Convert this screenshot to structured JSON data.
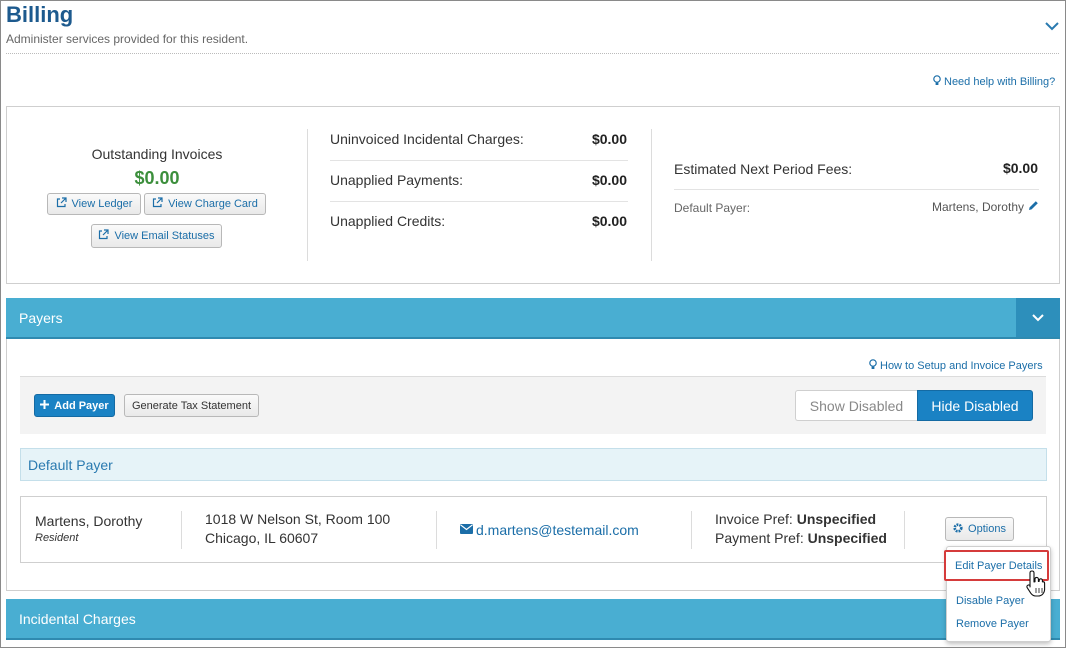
{
  "header": {
    "title": "Billing",
    "subtitle": "Administer services provided for this resident.",
    "help_link": "Need help with Billing?"
  },
  "summary": {
    "outstanding_label": "Outstanding Invoices",
    "outstanding_value": "$0.00",
    "view_ledger": "View Ledger",
    "view_charge_card": "View Charge Card",
    "view_email_statuses": "View Email Statuses",
    "rows": [
      {
        "label": "Uninvoiced Incidental Charges:",
        "value": "$0.00"
      },
      {
        "label": "Unapplied Payments:",
        "value": "$0.00"
      },
      {
        "label": "Unapplied Credits:",
        "value": "$0.00"
      }
    ],
    "estimated_label": "Estimated Next Period Fees:",
    "estimated_value": "$0.00",
    "default_payer_label": "Default Payer:",
    "default_payer_value": "Martens, Dorothy"
  },
  "payers_panel": {
    "title": "Payers",
    "help_link": "How to Setup and Invoice Payers",
    "add_payer": "Add Payer",
    "generate_tax": "Generate Tax Statement",
    "show_disabled": "Show Disabled",
    "hide_disabled": "Hide Disabled",
    "default_payer_heading": "Default Payer",
    "payer": {
      "name": "Martens, Dorothy",
      "role": "Resident",
      "address_line1": "1018 W Nelson St, Room 100",
      "address_line2": "Chicago, IL 60607",
      "email": "d.martens@testemail.com",
      "invoice_pref_label": "Invoice Pref:",
      "invoice_pref_value": "Unspecified",
      "payment_pref_label": "Payment Pref:",
      "payment_pref_value": "Unspecified"
    },
    "options_button": "Options",
    "options_menu": [
      "Edit Payer Details",
      "Disable Payer",
      "Remove Payer"
    ]
  },
  "incidental_panel": {
    "title": "Incidental Charges"
  },
  "colors": {
    "title_blue": "#1d5a8e",
    "panel_bar": "#49aed2",
    "panel_toggle": "#2d8fbb",
    "money_green": "#3c8f3c",
    "primary_button": "#1a82c4",
    "highlight_red": "#d53b3b"
  }
}
